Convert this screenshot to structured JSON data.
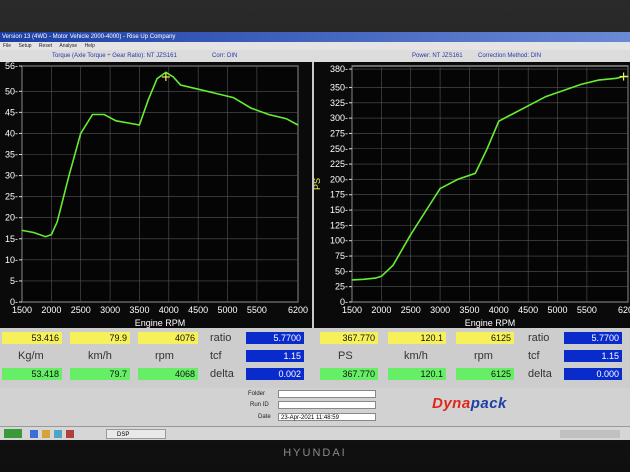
{
  "window": {
    "title": "Version 13 (4WD - Motor Vehicle 2000-4000) - Rise Up Company",
    "menu": [
      "File",
      "Setup",
      "Reset",
      "Analyse",
      "Help"
    ]
  },
  "infobar": {
    "left_label": "Torque (Axle Torque ÷ Gear Ratio): NT JZS161",
    "left_corr": "Corr: DIN",
    "right_label": "Power: NT JZS161",
    "right_corr": "Correction Method: DIN"
  },
  "legend_colors": [
    "#ff2a2a",
    "#22cc22",
    "#5a7bff",
    "#ff33ff",
    "#33dddd",
    "#cc6622"
  ],
  "chart_data": [
    {
      "type": "line",
      "xlabel": "Engine RPM",
      "ylabel": "",
      "xlim": [
        1500,
        6200
      ],
      "ylim": [
        0,
        56
      ],
      "x_ticks": [
        1500,
        2000,
        2500,
        3000,
        3500,
        4000,
        4500,
        5000,
        5500,
        6200
      ],
      "y_ticks": [
        0,
        5,
        10,
        15,
        20,
        25,
        30,
        35,
        40,
        45,
        50,
        56
      ],
      "grid": true,
      "line_color": "#66ee33",
      "series": [
        {
          "x": [
            1500,
            1700,
            1900,
            2000,
            2100,
            2300,
            2500,
            2700,
            2900,
            3100,
            3300,
            3500,
            3650,
            3800,
            3950,
            4076,
            4200,
            4500,
            4800,
            5100,
            5400,
            5700,
            6000,
            6200
          ],
          "y": [
            17,
            16.5,
            15.5,
            16,
            19,
            30,
            40,
            44.5,
            44.5,
            43,
            42.5,
            42,
            48,
            53,
            54.5,
            53.4,
            51.5,
            50.5,
            49.5,
            48.5,
            46,
            44.5,
            43.5,
            42
          ]
        }
      ],
      "marker": {
        "x": 3950,
        "y": 53.4
      }
    },
    {
      "type": "line",
      "xlabel": "Engine RPM",
      "ylabel": "PS",
      "xlim": [
        1500,
        6200
      ],
      "ylim": [
        0,
        385
      ],
      "x_ticks": [
        1500,
        2000,
        2500,
        3000,
        3500,
        4000,
        4500,
        5000,
        5500,
        6200
      ],
      "y_ticks": [
        0,
        25,
        50,
        75,
        100,
        125,
        150,
        175,
        200,
        225,
        250,
        275,
        300,
        325,
        350,
        380
      ],
      "grid": true,
      "line_color": "#66ee33",
      "series": [
        {
          "x": [
            1500,
            1700,
            1900,
            2000,
            2200,
            2500,
            2800,
            3000,
            3300,
            3600,
            3800,
            4000,
            4200,
            4500,
            4800,
            5100,
            5400,
            5700,
            6000,
            6125,
            6200
          ],
          "y": [
            36,
            37,
            39,
            42,
            60,
            110,
            155,
            185,
            200,
            210,
            250,
            295,
            305,
            320,
            335,
            345,
            355,
            362,
            365,
            367.8,
            368
          ]
        }
      ],
      "marker": {
        "x": 6125,
        "y": 367.8
      }
    }
  ],
  "readouts": {
    "left": {
      "measured": {
        "torque": "53.416",
        "speed": "79.9",
        "rpm": "4076"
      },
      "units": {
        "torque": "Kg/m",
        "speed": "km/h",
        "rpm": "rpm"
      },
      "compare": {
        "torque": "53.418",
        "speed": "79.7",
        "rpm": "4068"
      },
      "ratio_label": "ratio",
      "ratio_value": "5.7700",
      "tcf_label": "tcf",
      "tcf_value": "1.15",
      "delta_label": "delta",
      "delta_value": "0.002"
    },
    "right": {
      "measured": {
        "power": "367.770",
        "speed": "120.1",
        "rpm": "6125"
      },
      "units": {
        "power": "PS",
        "speed": "km/h",
        "rpm": "rpm"
      },
      "compare": {
        "power": "367.770",
        "speed": "120.1",
        "rpm": "6125"
      },
      "ratio_label": "ratio",
      "ratio_value": "5.7700",
      "tcf_label": "tcf",
      "tcf_value": "1.15",
      "delta_label": "delta",
      "delta_value": "0.000"
    }
  },
  "bottom": {
    "folder_label": "Folder",
    "folder_value": "",
    "runid_label": "Run ID",
    "runid_value": "",
    "date_label": "Date",
    "date_value": "23-Apr-2021 11:48:59",
    "logo_part1": "Dyna",
    "logo_part2": "pack"
  },
  "taskbar": {
    "app_label": "DSP"
  },
  "monitor_brand": "HYUNDAI"
}
